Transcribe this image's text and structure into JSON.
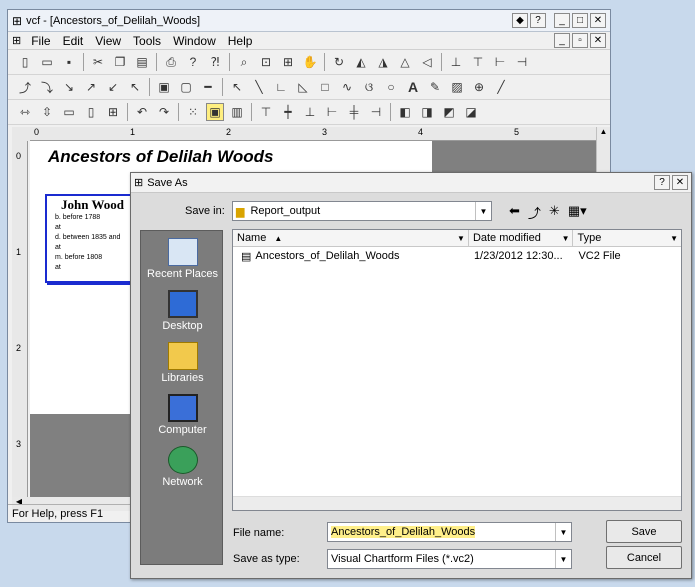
{
  "main": {
    "title": "vcf - [Ancestors_of_Delilah_Woods]",
    "menu": [
      "File",
      "Edit",
      "View",
      "Tools",
      "Window",
      "Help"
    ],
    "status": "For Help, press F1",
    "ruler_marks": [
      "0",
      "1",
      "2",
      "3",
      "4",
      "5"
    ],
    "vruler_marks": [
      "0",
      "1",
      "2",
      "3"
    ]
  },
  "chart": {
    "title": "Ancestors of Delilah Woods",
    "person": {
      "name": "John Wood",
      "lines": [
        "b. before 1788",
        "at",
        "d. between 1835 and",
        "at",
        "m. before 1808",
        "at"
      ]
    }
  },
  "dialog": {
    "title": "Save As",
    "save_in_label": "Save in:",
    "save_in_value": "Report_output",
    "places": [
      "Recent Places",
      "Desktop",
      "Libraries",
      "Computer",
      "Network"
    ],
    "columns": [
      "Name",
      "Date modified",
      "Type"
    ],
    "files": [
      {
        "name": "Ancestors_of_Delilah_Woods",
        "date": "1/23/2012 12:30...",
        "type": "VC2 File"
      }
    ],
    "file_name_label": "File name:",
    "file_name_value": "Ancestors_of_Delilah_Woods",
    "save_type_label": "Save as type:",
    "save_type_value": "Visual Chartform Files (*.vc2)",
    "save_button": "Save",
    "cancel_button": "Cancel"
  }
}
